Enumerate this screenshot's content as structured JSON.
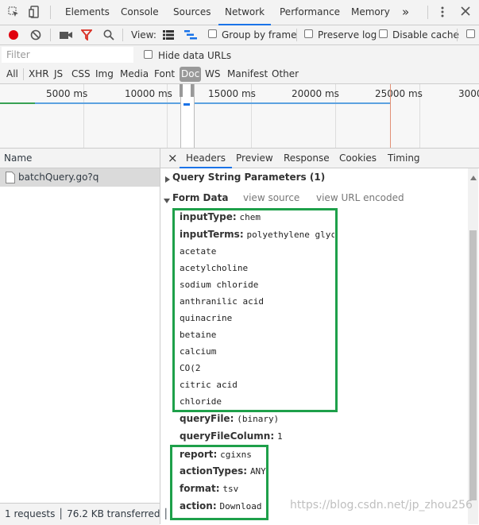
{
  "tabs": [
    "Elements",
    "Console",
    "Sources",
    "Network",
    "Performance",
    "Memory"
  ],
  "tabs_more": "»",
  "toolbar": {
    "view_label": "View:",
    "group_by_frame": "Group by frame",
    "preserve_log": "Preserve log",
    "disable_cache": "Disable cache"
  },
  "filter": {
    "placeholder": "Filter",
    "hide_data_urls": "Hide data URLs"
  },
  "types": [
    "All",
    "XHR",
    "JS",
    "CSS",
    "Img",
    "Media",
    "Font",
    "Doc",
    "WS",
    "Manifest",
    "Other"
  ],
  "selected_type": "Doc",
  "timeline": {
    "ticks": [
      "5000 ms",
      "10000 ms",
      "15000 ms",
      "20000 ms",
      "25000 ms",
      "3000"
    ]
  },
  "list": {
    "header": "Name",
    "requests": [
      "batchQuery.go?q"
    ],
    "status": "1 requests │ 76.2 KB transferred │"
  },
  "detail": {
    "close": "×",
    "tabs": [
      "Headers",
      "Preview",
      "Response",
      "Cookies",
      "Timing"
    ],
    "query_string_title": "Query String Parameters (1)",
    "form_data_title": "Form Data",
    "view_source": "view source",
    "view_url_encoded": "view URL encoded",
    "form": {
      "inputType_key": "inputType:",
      "inputType_val": "chem",
      "inputTerms_key": "inputTerms:",
      "inputTerms_val": "polyethylene glycol",
      "terms": [
        "acetate",
        "acetylcholine",
        "sodium chloride",
        "anthranilic acid",
        "quinacrine",
        "betaine",
        "calcium",
        "CO(2",
        "citric acid",
        "chloride"
      ],
      "queryFile_key": "queryFile:",
      "queryFile_val": "(binary)",
      "queryFileColumn_key": "queryFileColumn:",
      "queryFileColumn_val": "1",
      "report_key": "report:",
      "report_val": "cgixns",
      "actionTypes_key": "actionTypes:",
      "actionTypes_val": "ANY",
      "format_key": "format:",
      "format_val": "tsv",
      "action_key": "action:",
      "action_val": "Download"
    }
  },
  "watermark": "https://blog.csdn.net/jp_zhou256",
  "colors": {
    "accent": "#1a73e8",
    "record": "#e0000e",
    "highlight_box": "#1ea04a",
    "filter_icon": "#d93025"
  }
}
